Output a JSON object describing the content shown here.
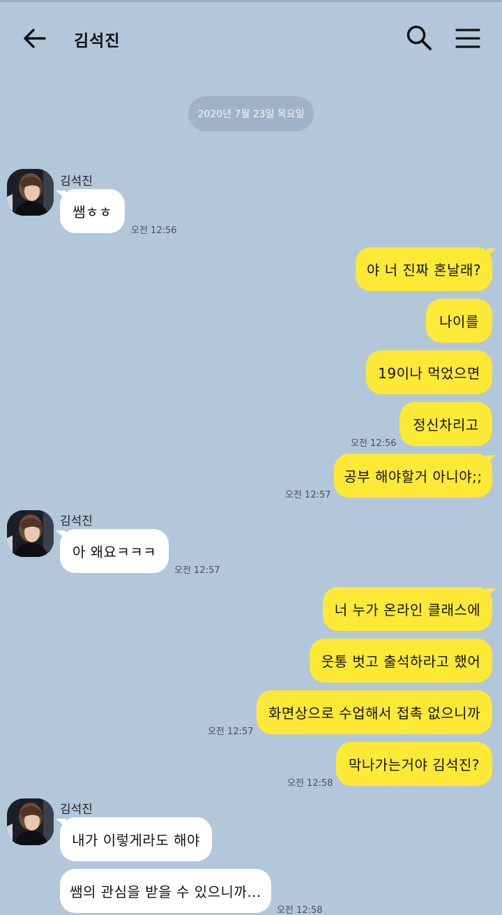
{
  "header": {
    "title": "김석진",
    "back_icon": "arrow-left-icon",
    "search_icon": "search-icon",
    "menu_icon": "hamburger-menu-icon"
  },
  "date_divider": "2020년 7월 23일 목요일",
  "contact": {
    "name": "김석진"
  },
  "messages": [
    {
      "dir": "in",
      "text": "쌤ㅎㅎ",
      "time": "오전 12:56"
    },
    {
      "dir": "out",
      "text": "야 너 진짜 혼날래?"
    },
    {
      "dir": "out",
      "text": "나이를"
    },
    {
      "dir": "out",
      "text": "19이나 먹었으면"
    },
    {
      "dir": "out",
      "text": "정신차리고",
      "time": "오전 12:56"
    },
    {
      "dir": "out",
      "text": "공부 해야할거 아니야;;",
      "time": "오전 12:57"
    },
    {
      "dir": "in",
      "text": "아 왜요ㅋㅋㅋ",
      "time": "오전 12:57"
    },
    {
      "dir": "out",
      "text": "너 누가 온라인 클래스에"
    },
    {
      "dir": "out",
      "text": "웃통 벗고 출석하라고 했어"
    },
    {
      "dir": "out",
      "text": "화면상으로 수업해서 접촉 없으니까",
      "time": "오전 12:57"
    },
    {
      "dir": "out",
      "text": "막나가는거야 김석진?",
      "time": "오전 12:58"
    },
    {
      "dir": "in",
      "text": "내가 이렇게라도 해야"
    },
    {
      "dir": "in",
      "text": "쌤의 관심을 받을 수 있으니까...",
      "time": "오전 12:58"
    }
  ],
  "colors": {
    "background": "#b2c7da",
    "outgoing_bubble": "#fde936",
    "incoming_bubble": "#ffffff",
    "date_pill": "#9fb3c6"
  }
}
